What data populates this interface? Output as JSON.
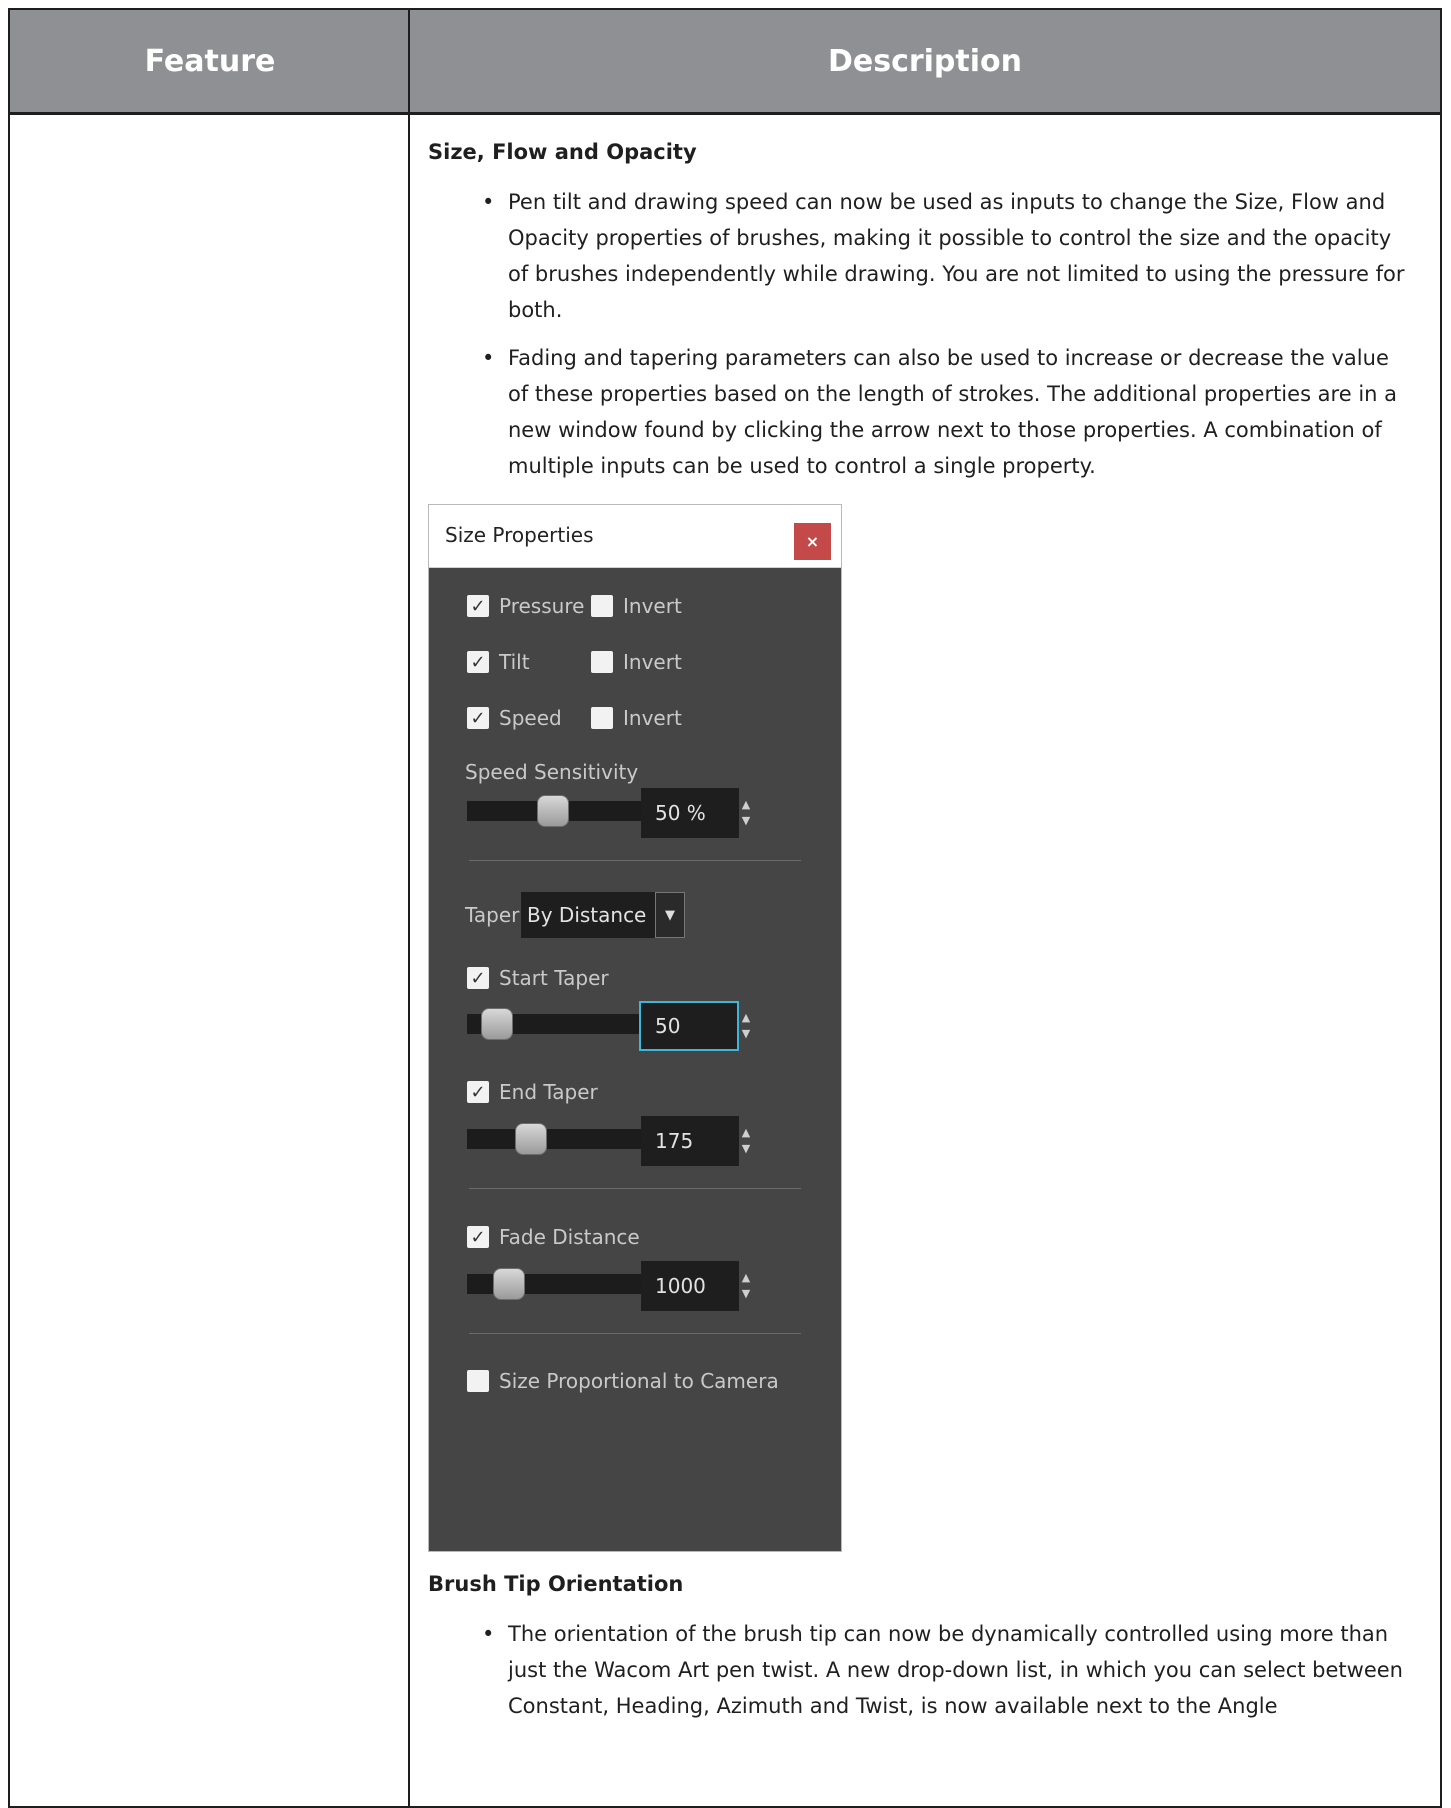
{
  "table": {
    "header_feature": "Feature",
    "header_description": "Description"
  },
  "section1": {
    "title": "Size, Flow and Opacity",
    "bullets": [
      "Pen tilt and drawing speed can now be used as inputs to change the Size, Flow and Opacity properties of brushes, making it possible to control the size and the opacity of brushes independently while drawing. You are not limited to using the pressure for both.",
      "Fading and tapering parameters can also be used to increase or decrease the value of these properties based on the length of strokes. The additional properties are in a new window found by clicking the arrow next to those properties. A combination of multiple inputs can be used to control a single property."
    ]
  },
  "panel": {
    "title": "Size Properties",
    "close_label": "×",
    "pressure": {
      "label": "Pressure",
      "checked": true
    },
    "pressure_invert": {
      "label": "Invert",
      "checked": false
    },
    "tilt": {
      "label": "Tilt",
      "checked": true
    },
    "tilt_invert": {
      "label": "Invert",
      "checked": false
    },
    "speed": {
      "label": "Speed",
      "checked": true
    },
    "speed_invert": {
      "label": "Invert",
      "checked": false
    },
    "speed_sensitivity": {
      "label": "Speed Sensitivity",
      "value": "50 %"
    },
    "taper": {
      "label": "Taper",
      "value": "By Distance"
    },
    "start_taper": {
      "label": "Start Taper",
      "checked": true,
      "value": "50"
    },
    "end_taper": {
      "label": "End Taper",
      "checked": true,
      "value": "175"
    },
    "fade_distance": {
      "label": "Fade Distance",
      "checked": true,
      "value": "1000"
    },
    "size_proportional": {
      "label": "Size Proportional to Camera",
      "checked": false
    }
  },
  "section2": {
    "title": "Brush Tip Orientation",
    "bullets": [
      "The orientation of the brush tip can now be dynamically controlled using more than just the Wacom Art pen twist. A new drop-down list, in which you can select between Constant, Heading, Azimuth and Twist, is now available next to the Angle"
    ]
  }
}
